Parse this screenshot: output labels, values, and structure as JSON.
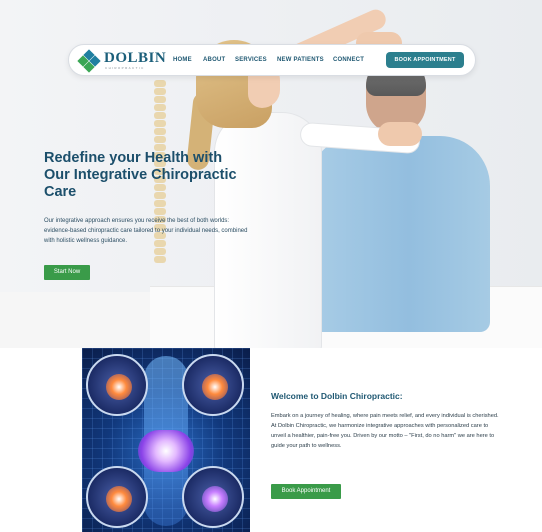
{
  "brand": {
    "name": "DOLBIN",
    "tagline": "CHIROPRACTIC",
    "colors": {
      "primary": "#1f5872",
      "accent": "#2c7f8e",
      "cta_green": "#3a9b49"
    }
  },
  "nav": {
    "items": [
      {
        "label": "HOME"
      },
      {
        "label": "ABOUT"
      },
      {
        "label": "SERVICES"
      },
      {
        "label": "NEW PATIENTS"
      },
      {
        "label": "CONNECT"
      }
    ],
    "cta_label": "BOOK APPOINTMENT"
  },
  "hero": {
    "title": "Redefine your Health with Our Integrative Chiropractic Care",
    "description": "Our integrative approach ensures you receive the best of both worlds: evidence-based chiropractic care tailored to your individual needs, combined with holistic wellness guidance.",
    "button_label": "Start Now"
  },
  "welcome": {
    "title": "Welcome to Dolbin Chiropractic:",
    "text": "Embark on a journey of healing, where pain meets relief, and every individual is cherished. At Dolbin Chiropractic, we harmonize integrative approaches with personalized care to unveil a healthier, pain-free you. Driven by our motto – \"First, do no harm\" we are here to guide your path to wellness.",
    "button_label": "Book Appointment",
    "image_icon": "joint-pain-illustration"
  }
}
